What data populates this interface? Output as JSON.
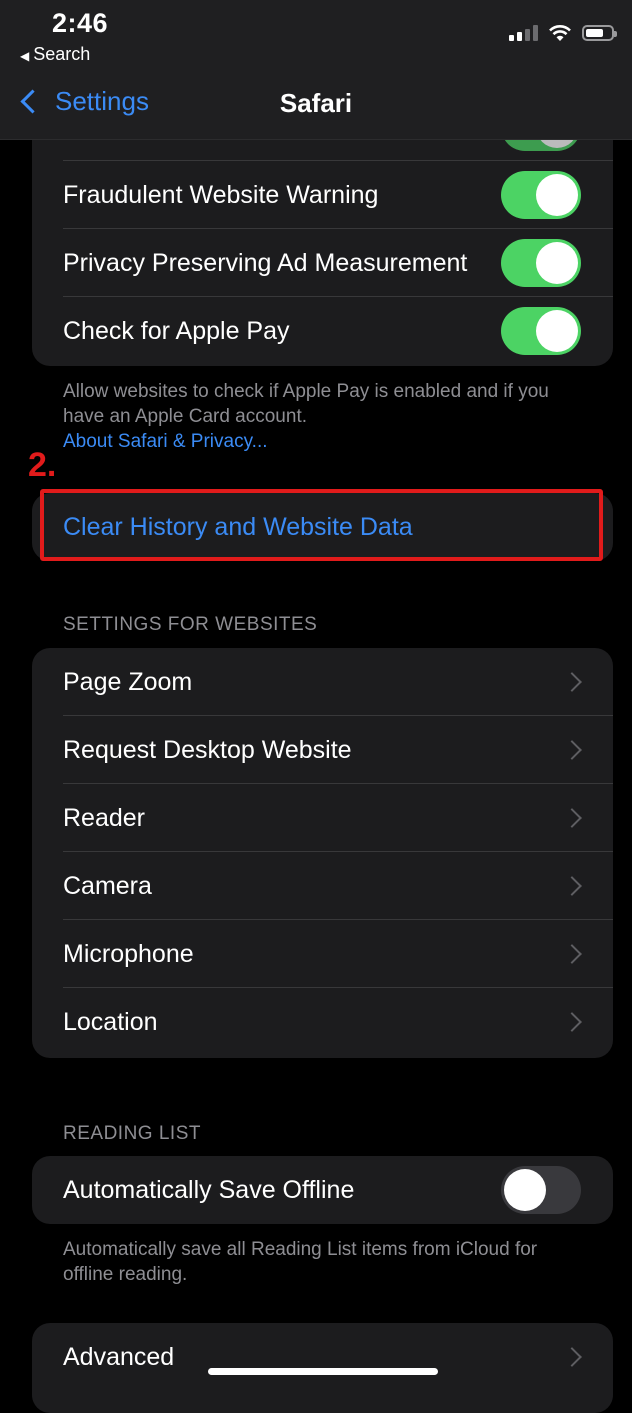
{
  "status_bar": {
    "time": "2:46",
    "back_app": "Search"
  },
  "nav": {
    "back_label": "Settings",
    "title": "Safari"
  },
  "privacy_group": {
    "rows": [
      {
        "label": "Fraudulent Website Warning",
        "on": true
      },
      {
        "label": "Privacy Preserving Ad Measurement",
        "on": true
      },
      {
        "label": "Check for Apple Pay",
        "on": true
      }
    ]
  },
  "privacy_footer": {
    "text": "Allow websites to check if Apple Pay is enabled and if you have an Apple Card account.",
    "link": "About Safari & Privacy..."
  },
  "clear_history": {
    "label": "Clear History and Website Data"
  },
  "annotation": {
    "step": "2."
  },
  "settings_for_websites": {
    "header": "SETTINGS FOR WEBSITES",
    "items": [
      "Page Zoom",
      "Request Desktop Website",
      "Reader",
      "Camera",
      "Microphone",
      "Location"
    ]
  },
  "reading_list": {
    "header": "READING LIST",
    "auto_save_label": "Automatically Save Offline",
    "auto_save_on": false,
    "footer": "Automatically save all Reading List items from iCloud for offline reading."
  },
  "advanced": {
    "label": "Advanced"
  },
  "colors": {
    "accent": "#3b8bf5",
    "toggle_on": "#4cd364",
    "annotation": "#e11b1b"
  }
}
